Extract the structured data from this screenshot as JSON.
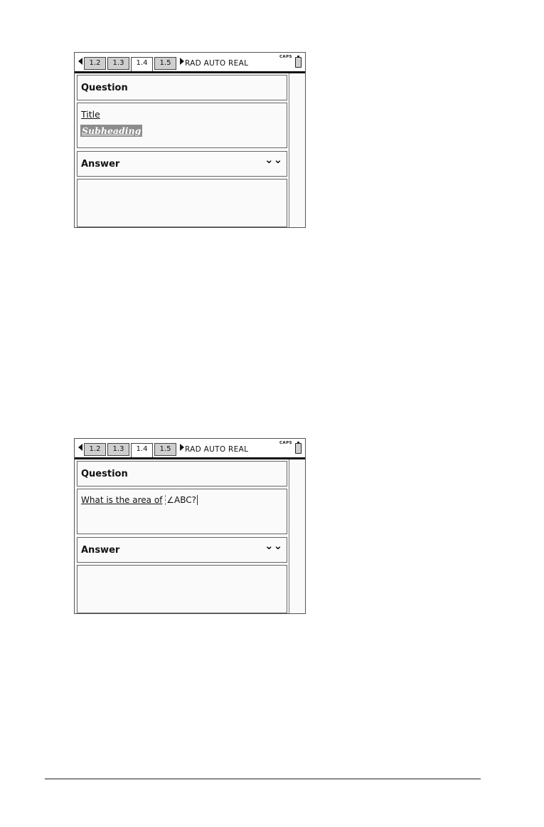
{
  "screens": [
    {
      "tabs": [
        "1.2",
        "1.3",
        "1.4",
        "1.5"
      ],
      "active_tab": "1.4",
      "status": "RAD  AUTO  REAL",
      "caps": "CAPS",
      "question_label": "Question",
      "question_body": {
        "title": "Title",
        "subheading": "Subheading"
      },
      "answer_label": "Answer",
      "answer_chevron": "⌄⌄"
    },
    {
      "tabs": [
        "1.2",
        "1.3",
        "1.4",
        "1.5"
      ],
      "active_tab": "1.4",
      "status": "RAD  AUTO  REAL",
      "caps": "CAPS",
      "question_label": "Question",
      "question_body": {
        "text": "What is the area of",
        "math": "∠ABC?"
      },
      "answer_label": "Answer",
      "answer_chevron": "⌄⌄"
    }
  ]
}
